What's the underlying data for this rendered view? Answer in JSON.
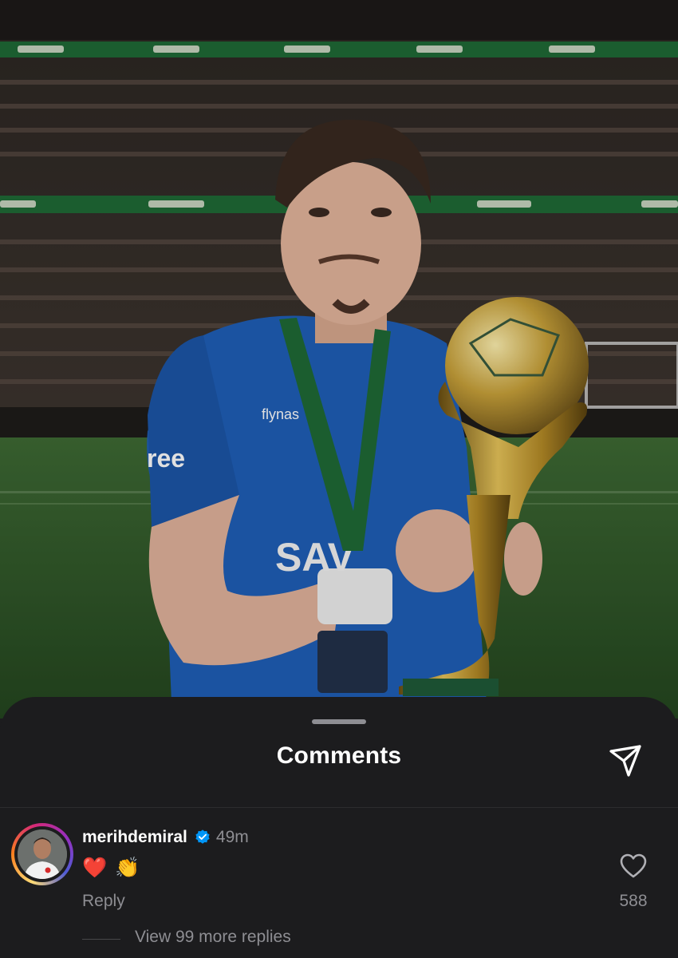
{
  "photo": {
    "description_icons": [
      "stadium",
      "player",
      "trophy"
    ],
    "colors": {
      "pitch": "#2f5a2a",
      "shirt": "#1f5fb8",
      "gold": "#c9a23a",
      "banner": "#1f7a3a"
    }
  },
  "sheet": {
    "title": "Comments",
    "share_icon": "send-icon"
  },
  "comment": {
    "username": "merihdemiral",
    "verified": true,
    "time": "49m",
    "emojis": [
      "❤️",
      "👏"
    ],
    "reply_label": "Reply",
    "like_count": "588",
    "view_more": "View 99 more replies"
  },
  "colors": {
    "accent_verified": "#0095f6",
    "heart_red": "#ff3040"
  }
}
